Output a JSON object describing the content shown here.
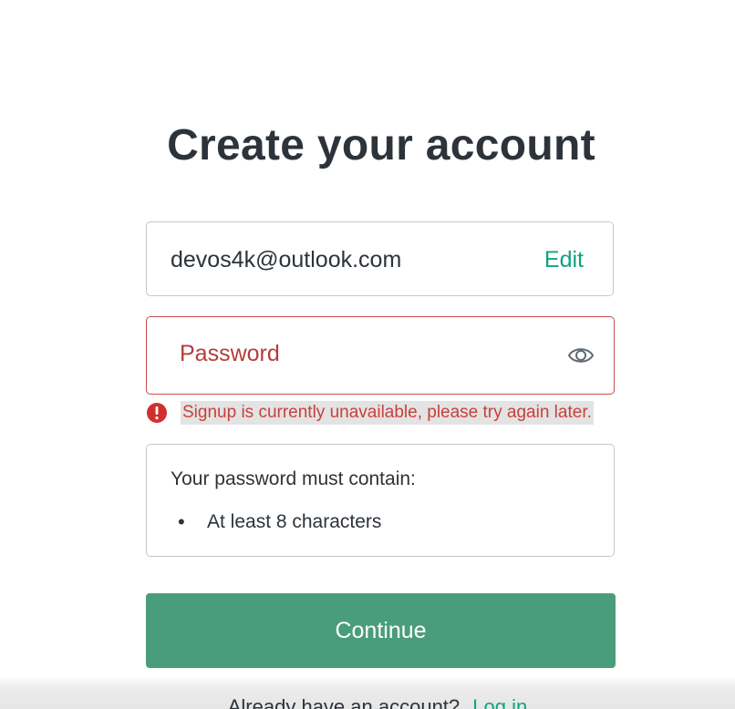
{
  "title": "Create your account",
  "email": {
    "value": "devos4k@outlook.com",
    "edit_label": "Edit"
  },
  "password": {
    "placeholder": "Password",
    "value": "",
    "toggle_icon": "eye-icon"
  },
  "error": {
    "icon": "error-circle-icon",
    "message": "Signup is currently unavailable, please try again later."
  },
  "requirements": {
    "heading": "Your password must contain:",
    "items": [
      {
        "bullet": "•",
        "text": "At least 8 characters"
      }
    ]
  },
  "continue_label": "Continue",
  "footer": {
    "prompt": "Already have an account?",
    "login_label": "Log in"
  },
  "colors": {
    "accent": "#10a37f",
    "button": "#4a9d7c",
    "error": "#c9403a",
    "error_border": "#cb4b4b",
    "text": "#2d333a"
  }
}
